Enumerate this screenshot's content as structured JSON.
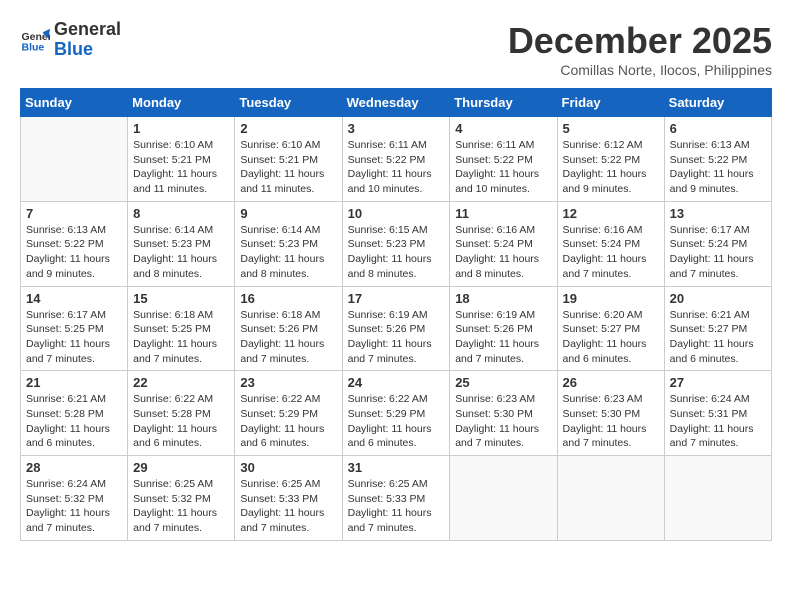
{
  "header": {
    "logo_line1": "General",
    "logo_line2": "Blue",
    "month": "December 2025",
    "location": "Comillas Norte, Ilocos, Philippines"
  },
  "weekdays": [
    "Sunday",
    "Monday",
    "Tuesday",
    "Wednesday",
    "Thursday",
    "Friday",
    "Saturday"
  ],
  "weeks": [
    [
      {
        "day": "",
        "sunrise": "",
        "sunset": "",
        "daylight": ""
      },
      {
        "day": "1",
        "sunrise": "6:10 AM",
        "sunset": "5:21 PM",
        "daylight": "11 hours and 11 minutes."
      },
      {
        "day": "2",
        "sunrise": "6:10 AM",
        "sunset": "5:21 PM",
        "daylight": "11 hours and 11 minutes."
      },
      {
        "day": "3",
        "sunrise": "6:11 AM",
        "sunset": "5:22 PM",
        "daylight": "11 hours and 10 minutes."
      },
      {
        "day": "4",
        "sunrise": "6:11 AM",
        "sunset": "5:22 PM",
        "daylight": "11 hours and 10 minutes."
      },
      {
        "day": "5",
        "sunrise": "6:12 AM",
        "sunset": "5:22 PM",
        "daylight": "11 hours and 9 minutes."
      },
      {
        "day": "6",
        "sunrise": "6:13 AM",
        "sunset": "5:22 PM",
        "daylight": "11 hours and 9 minutes."
      }
    ],
    [
      {
        "day": "7",
        "sunrise": "6:13 AM",
        "sunset": "5:22 PM",
        "daylight": "11 hours and 9 minutes."
      },
      {
        "day": "8",
        "sunrise": "6:14 AM",
        "sunset": "5:23 PM",
        "daylight": "11 hours and 8 minutes."
      },
      {
        "day": "9",
        "sunrise": "6:14 AM",
        "sunset": "5:23 PM",
        "daylight": "11 hours and 8 minutes."
      },
      {
        "day": "10",
        "sunrise": "6:15 AM",
        "sunset": "5:23 PM",
        "daylight": "11 hours and 8 minutes."
      },
      {
        "day": "11",
        "sunrise": "6:16 AM",
        "sunset": "5:24 PM",
        "daylight": "11 hours and 8 minutes."
      },
      {
        "day": "12",
        "sunrise": "6:16 AM",
        "sunset": "5:24 PM",
        "daylight": "11 hours and 7 minutes."
      },
      {
        "day": "13",
        "sunrise": "6:17 AM",
        "sunset": "5:24 PM",
        "daylight": "11 hours and 7 minutes."
      }
    ],
    [
      {
        "day": "14",
        "sunrise": "6:17 AM",
        "sunset": "5:25 PM",
        "daylight": "11 hours and 7 minutes."
      },
      {
        "day": "15",
        "sunrise": "6:18 AM",
        "sunset": "5:25 PM",
        "daylight": "11 hours and 7 minutes."
      },
      {
        "day": "16",
        "sunrise": "6:18 AM",
        "sunset": "5:26 PM",
        "daylight": "11 hours and 7 minutes."
      },
      {
        "day": "17",
        "sunrise": "6:19 AM",
        "sunset": "5:26 PM",
        "daylight": "11 hours and 7 minutes."
      },
      {
        "day": "18",
        "sunrise": "6:19 AM",
        "sunset": "5:26 PM",
        "daylight": "11 hours and 7 minutes."
      },
      {
        "day": "19",
        "sunrise": "6:20 AM",
        "sunset": "5:27 PM",
        "daylight": "11 hours and 6 minutes."
      },
      {
        "day": "20",
        "sunrise": "6:21 AM",
        "sunset": "5:27 PM",
        "daylight": "11 hours and 6 minutes."
      }
    ],
    [
      {
        "day": "21",
        "sunrise": "6:21 AM",
        "sunset": "5:28 PM",
        "daylight": "11 hours and 6 minutes."
      },
      {
        "day": "22",
        "sunrise": "6:22 AM",
        "sunset": "5:28 PM",
        "daylight": "11 hours and 6 minutes."
      },
      {
        "day": "23",
        "sunrise": "6:22 AM",
        "sunset": "5:29 PM",
        "daylight": "11 hours and 6 minutes."
      },
      {
        "day": "24",
        "sunrise": "6:22 AM",
        "sunset": "5:29 PM",
        "daylight": "11 hours and 6 minutes."
      },
      {
        "day": "25",
        "sunrise": "6:23 AM",
        "sunset": "5:30 PM",
        "daylight": "11 hours and 7 minutes."
      },
      {
        "day": "26",
        "sunrise": "6:23 AM",
        "sunset": "5:30 PM",
        "daylight": "11 hours and 7 minutes."
      },
      {
        "day": "27",
        "sunrise": "6:24 AM",
        "sunset": "5:31 PM",
        "daylight": "11 hours and 7 minutes."
      }
    ],
    [
      {
        "day": "28",
        "sunrise": "6:24 AM",
        "sunset": "5:32 PM",
        "daylight": "11 hours and 7 minutes."
      },
      {
        "day": "29",
        "sunrise": "6:25 AM",
        "sunset": "5:32 PM",
        "daylight": "11 hours and 7 minutes."
      },
      {
        "day": "30",
        "sunrise": "6:25 AM",
        "sunset": "5:33 PM",
        "daylight": "11 hours and 7 minutes."
      },
      {
        "day": "31",
        "sunrise": "6:25 AM",
        "sunset": "5:33 PM",
        "daylight": "11 hours and 7 minutes."
      },
      {
        "day": "",
        "sunrise": "",
        "sunset": "",
        "daylight": ""
      },
      {
        "day": "",
        "sunrise": "",
        "sunset": "",
        "daylight": ""
      },
      {
        "day": "",
        "sunrise": "",
        "sunset": "",
        "daylight": ""
      }
    ]
  ]
}
